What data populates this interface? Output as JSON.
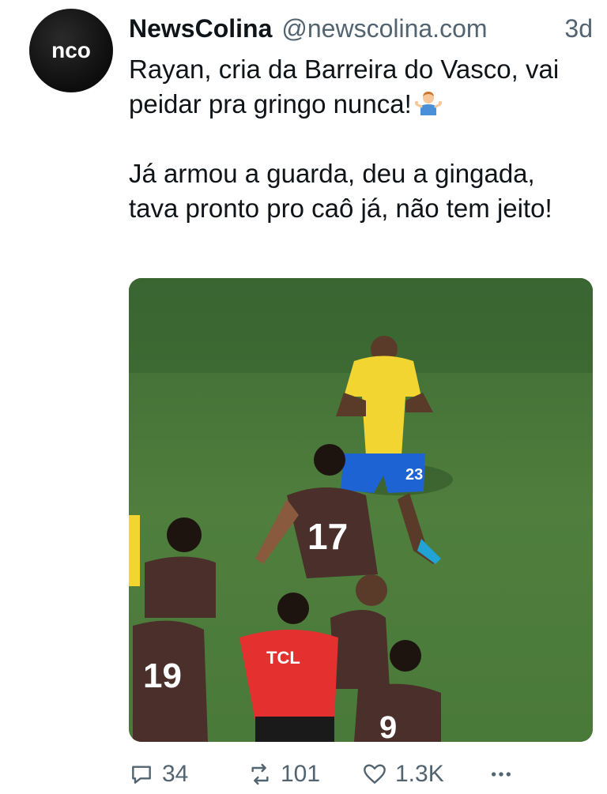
{
  "author": {
    "display_name": "NewsColina",
    "handle": "@newscolina.com",
    "avatar_text": "nco"
  },
  "time": "3d",
  "text": {
    "paragraph_1": "Rayan, cria da Barreira do Vasco, vai peidar pra gringo nunca!",
    "emoji": "person-shrugging-emoji",
    "paragraph_2": "Já armou a guarda, deu a gingada, tava pronto pro caô já, não tem jeito!"
  },
  "media": {
    "jersey_numbers": [
      "17",
      "19",
      "9",
      "23"
    ],
    "sponsor_text": "TCL"
  },
  "actions": {
    "reply_count": "34",
    "retweet_count": "101",
    "like_count": "1.3K",
    "more_icon": "more-dots-icon"
  },
  "colors": {
    "text": "#0f1419",
    "secondary": "#536471",
    "pitch": "#4d7a3a"
  }
}
